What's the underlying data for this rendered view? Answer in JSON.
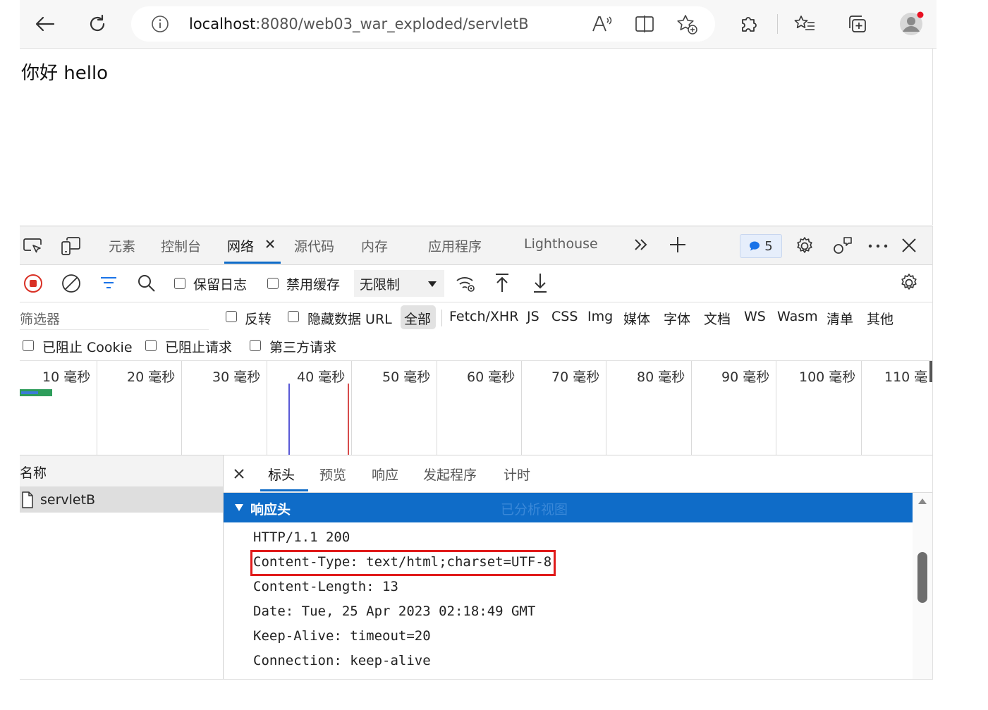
{
  "browser": {
    "url": "localhost:8080/web03_war_exploded/servletB",
    "url_host": "localhost",
    "url_rest": ":8080/web03_war_exploded/servletB"
  },
  "page": {
    "body_text": "你好 hello"
  },
  "devtools": {
    "tabs": [
      "元素",
      "控制台",
      "网络",
      "源代码",
      "内存",
      "应用程序",
      "Lighthouse"
    ],
    "active_tab": "网络",
    "issues_count": "5",
    "toolbar": {
      "preserve_log": "保留日志",
      "disable_cache": "禁用缓存",
      "throttling": "无限制"
    },
    "filter": {
      "placeholder": "筛选器",
      "invert": "反转",
      "hide_data_urls": "隐藏数据 URL",
      "types": [
        "全部",
        "Fetch/XHR",
        "JS",
        "CSS",
        "Img",
        "媒体",
        "字体",
        "文档",
        "WS",
        "Wasm",
        "清单",
        "其他"
      ],
      "blocked_cookies": "已阻止 Cookie",
      "blocked_requests": "已阻止请求",
      "third_party": "第三方请求"
    },
    "timeline": [
      "10 毫秒",
      "20 毫秒",
      "30 毫秒",
      "40 毫秒",
      "50 毫秒",
      "60 毫秒",
      "70 毫秒",
      "80 毫秒",
      "90 毫秒",
      "100 毫秒",
      "110 毫"
    ],
    "name_column": "名称",
    "requests": [
      {
        "name": "servletB"
      }
    ],
    "detail_tabs": [
      "标头",
      "预览",
      "响应",
      "发起程序",
      "计时"
    ],
    "active_detail_tab": "标头",
    "response_headers": {
      "title": "响应头",
      "view_toggle": "已分析视图",
      "lines": [
        "HTTP/1.1 200",
        "Content-Type: text/html;charset=UTF-8",
        "Content-Length: 13",
        "Date: Tue, 25 Apr 2023 02:18:49 GMT",
        "Keep-Alive: timeout=20",
        "Connection: keep-alive"
      ],
      "highlighted_line": "Content-Type: text/html;charset=UTF-8"
    }
  },
  "colors": {
    "section_header": "#0f6cc8",
    "highlight_box": "#e01b1b",
    "record_button": "#d93025",
    "filter_icon": "#1a73e8",
    "dom_content_line": "#5a5ad6",
    "load_line": "#d64b4b",
    "waterfall_bar": "#2e9d5b"
  }
}
